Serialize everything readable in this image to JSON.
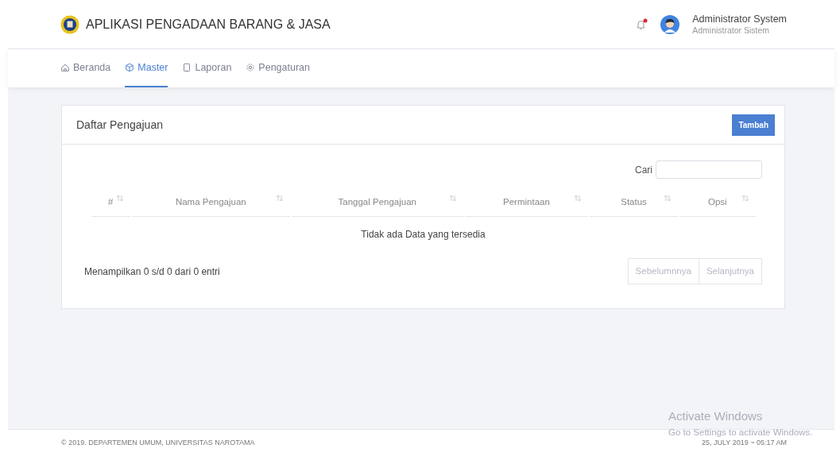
{
  "header": {
    "title": "APLIKASI PENGADAAN BARANG & JASA",
    "notification": {
      "unread": true
    },
    "user": {
      "name": "Administrator System",
      "role": "Administrator Sistem"
    }
  },
  "nav": [
    {
      "label": "Beranda",
      "selected": false
    },
    {
      "label": "Master",
      "selected": true
    },
    {
      "label": "Laporan",
      "selected": false
    },
    {
      "label": "Pengaturan",
      "selected": false
    }
  ],
  "card": {
    "title": "Daftar Pengajuan",
    "add_button": "Tambah",
    "search": {
      "label": "Cari"
    },
    "table": {
      "columns": [
        "#",
        "Nama Pengajuan",
        "Tanggal Pengajuan",
        "Permintaan",
        "Status",
        "Opsi"
      ],
      "empty_message": "Tidak ada Data yang tersedia"
    },
    "info": "Menampilkan 0 s/d 0 dari 0 entri",
    "pagination": [
      {
        "label": "Sebelumnnya",
        "disabled": true
      },
      {
        "label": "Selanjutnya",
        "disabled": true
      }
    ]
  },
  "footer": {
    "copyright": "© 2019. DEPARTEMEN UMUM, UNIVERSITAS NAROTAMA",
    "datetime": "25, JULY 2019 ~ 05:17 AM"
  },
  "os_overlay": {
    "title": "Activate Windows",
    "subtitle": "Go to Settings to activate Windows."
  }
}
